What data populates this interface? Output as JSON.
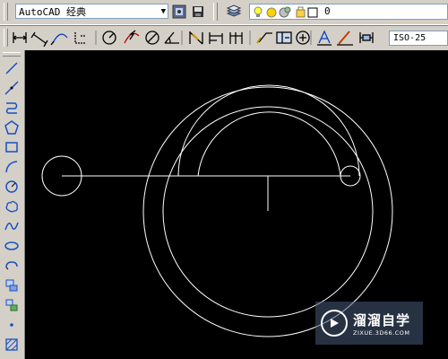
{
  "toolbar": {
    "workspace_value": "AutoCAD 经典",
    "layer_name": "0",
    "dimstyle_value": "ISO-25"
  },
  "left_tools": [
    "line-icon",
    "construction-line-icon",
    "polyline-icon",
    "polygon-icon",
    "rectangle-icon",
    "arc-icon",
    "circle-icon",
    "revision-cloud-icon",
    "spline-icon",
    "ellipse-icon",
    "ellipse-arc-icon",
    "insert-block-icon",
    "make-block-icon",
    "point-icon",
    "hatch-icon"
  ],
  "watermark": {
    "title": "溜溜自学",
    "url": "ZIXUE.3D66.COM"
  },
  "colors": {
    "canvas": "#000000",
    "geometry": "#ffffff",
    "chrome": "#d4d0c8"
  }
}
